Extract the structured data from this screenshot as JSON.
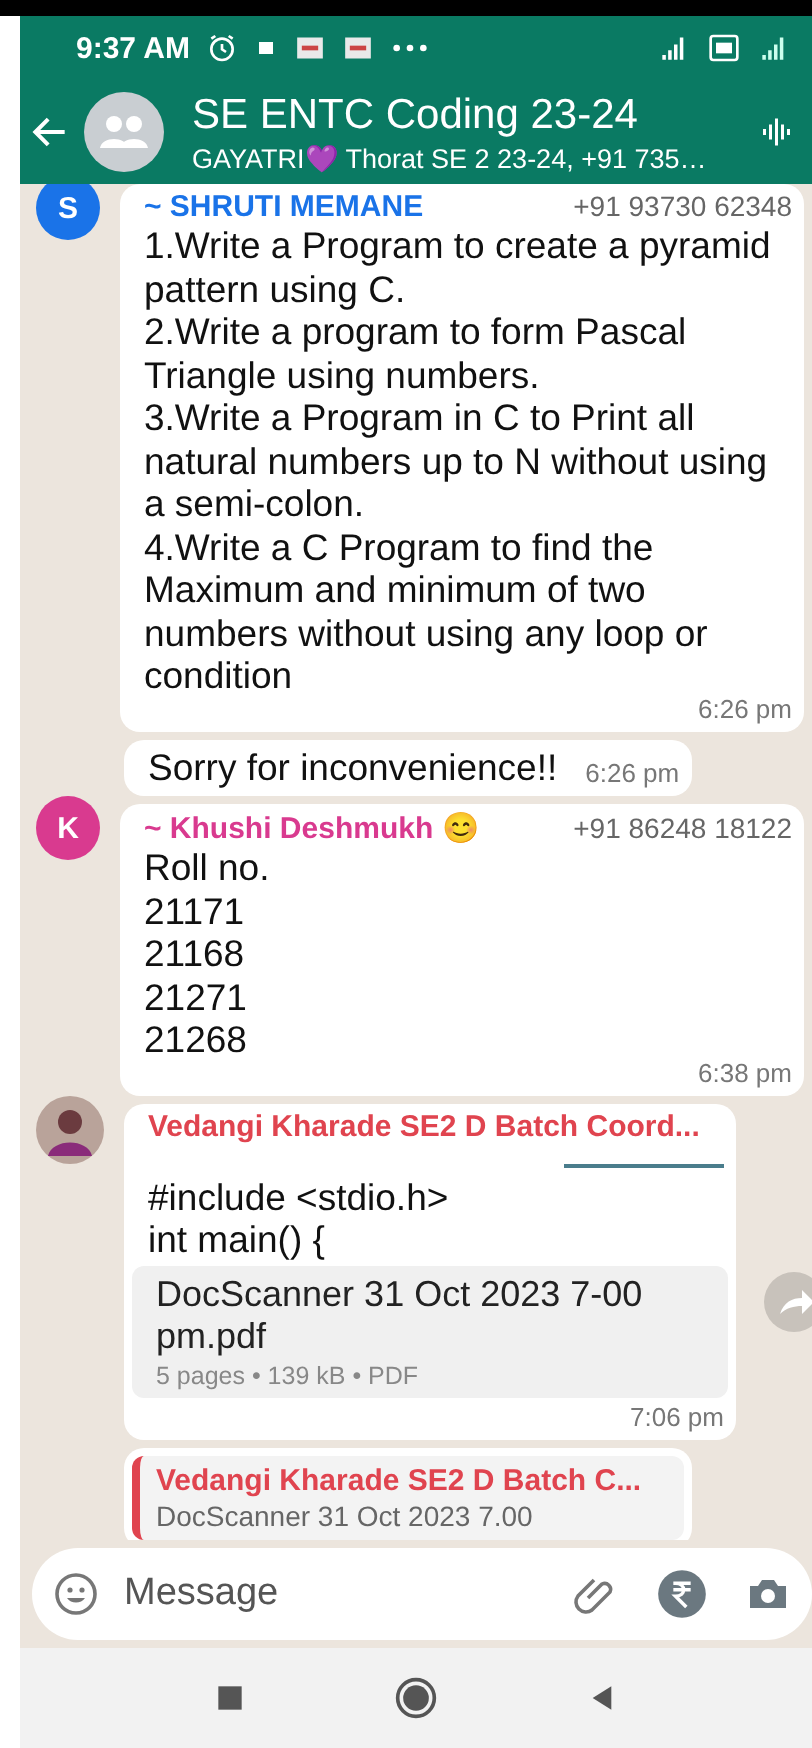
{
  "status_bar": {
    "time": "9:37 AM"
  },
  "header": {
    "title": "SE ENTC Coding 23-24",
    "subtitle": "GAYATRI💜 Thorat SE 2 23-24, +91 735…"
  },
  "messages": [
    {
      "kind": "text",
      "avatar": "S",
      "color": "#1a73e8",
      "sender": "~ SHRUTI MEMANE",
      "phone": "+91 93730 62348",
      "text": "1.Write a Program to create a pyramid pattern using C.\n2.Write a program to form Pascal Triangle using numbers.\n3.Write a Program in C to Print all natural numbers up to N without using a semi-colon.\n4.Write a C Program to find the Maximum and minimum of two numbers without using any loop or condition",
      "time": "6:26 pm"
    },
    {
      "kind": "text",
      "text": "Sorry for inconvenience!!",
      "time": "6:26 pm"
    },
    {
      "kind": "text",
      "avatar": "K",
      "color": "#d93a8f",
      "sender": "~ Khushi Deshmukh 😊",
      "phone": "+91 86248 18122",
      "text": "Roll no.\n21171\n21168\n21271\n21268",
      "time": "6:38 pm"
    },
    {
      "kind": "document",
      "color": "#e0444f",
      "sender": "Vedangi Kharade SE2 D Batch Coord...",
      "preview": "#include <stdio.h>\nint main() {",
      "file": "DocScanner 31 Oct 2023 7-00 pm.pdf",
      "meta": "5 pages • 139 kB • PDF",
      "time": "7:06 pm"
    },
    {
      "kind": "reply",
      "color": "#e0444f",
      "sender": "Vedangi Kharade SE2 D Batch C...",
      "quote": "DocScanner 31 Oct 2023 7.00"
    }
  ],
  "composer": {
    "placeholder": "Message"
  }
}
